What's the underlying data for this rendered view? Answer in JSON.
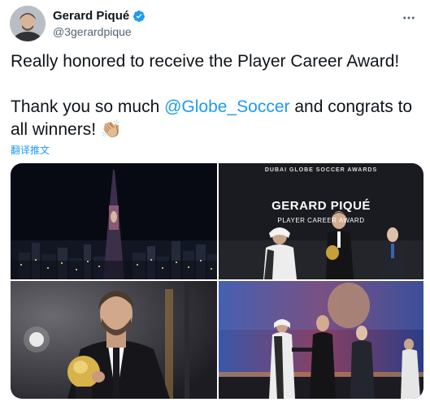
{
  "user": {
    "name": "Gerard Piqué",
    "handle": "@3gerardpique"
  },
  "tweet": {
    "line1": "Really honored to receive the Player Career Award!",
    "line2_prefix": "Thank you so much ",
    "mention": "@Globe_Soccer",
    "line2_suffix": " and congrats to all winners!",
    "emoji": "👏🏼",
    "translate": "翻译推文"
  },
  "photos": {
    "stage_brand": "DUBAI GLOBE SOCCER AWARDS",
    "stage_name": "GERARD PIQUÉ",
    "stage_award": "PLAYER CAREER AWARD"
  },
  "colors": {
    "link": "#1d9bf0",
    "verified": "#1d9bf0",
    "text": "#0f1419",
    "secondary": "#536471"
  }
}
